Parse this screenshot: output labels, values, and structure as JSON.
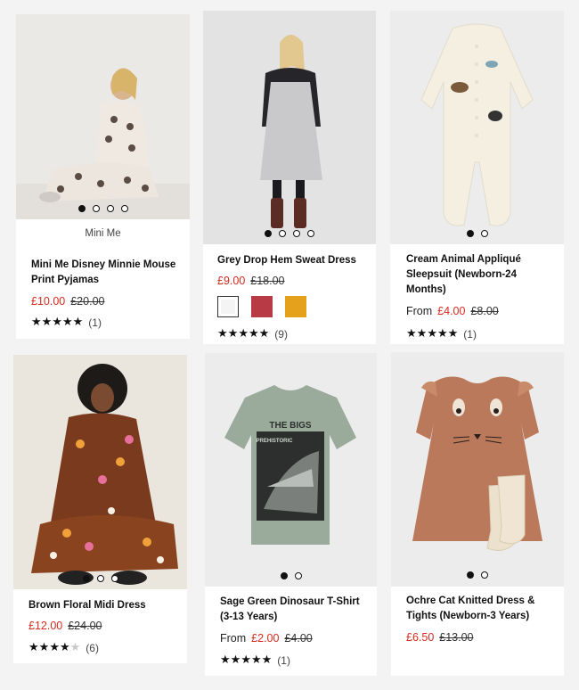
{
  "products": [
    {
      "title": "Mini Me Disney Minnie Mouse Print Pyjamas",
      "title_line1": "Mini Me Disney Minnie Mouse",
      "title_line2": "Print Pyjamas",
      "tag": "Mini Me",
      "price_now": "£10.00",
      "price_was": "£20.00",
      "rating_count": "(1)",
      "rating": 5,
      "image_count": 4,
      "active_image": 1
    },
    {
      "title": "Grey Drop Hem Sweat Dress",
      "price_now": "£9.00",
      "price_was": "£18.00",
      "rating_count": "(9)",
      "rating": 5,
      "image_count": 4,
      "active_image": 1,
      "swatch_colors": [
        "#f4f4f4",
        "#b83a45",
        "#e5a11b"
      ]
    },
    {
      "title": "Cream Animal Appliqué Sleepsuit (Newborn-24 Months)",
      "title_line1": "Cream Animal Appliqué",
      "title_line2": "Sleepsuit (Newborn-24",
      "title_line3": "Months)",
      "from_label": "From",
      "price_now": "£4.00",
      "price_was": "£8.00",
      "rating_count": "(1)",
      "rating": 5,
      "image_count": 2,
      "active_image": 1
    },
    {
      "title": "Brown Floral Midi Dress",
      "price_now": "£12.00",
      "price_was": "£24.00",
      "rating_count": "(6)",
      "rating": 4,
      "image_count": 3,
      "active_image": 1
    },
    {
      "title": "Sage Green Dinosaur T-Shirt (3-13 Years)",
      "title_line1": "Sage Green Dinosaur T-Shirt",
      "title_line2": "(3-13 Years)",
      "from_label": "From",
      "price_now": "£2.00",
      "price_was": "£4.00",
      "rating_count": "(1)",
      "rating": 5,
      "image_count": 2,
      "active_image": 1
    },
    {
      "title": "Ochre Cat Knitted Dress & Tights (Newborn-3 Years)",
      "title_line1": "Ochre Cat Knitted Dress &",
      "title_line2": "Tights (Newborn-3 Years)",
      "price_now": "£6.50",
      "price_was": "£13.00",
      "rating_count": "",
      "image_count": 2,
      "active_image": 1
    }
  ],
  "colors": {
    "sale_price": "#d62a1e",
    "page_bg": "#f3f3f3",
    "card_bg": "#ffffff"
  },
  "tshirt_print": {
    "brand": "PREHISTORIC",
    "headline": "THE BIGS"
  }
}
